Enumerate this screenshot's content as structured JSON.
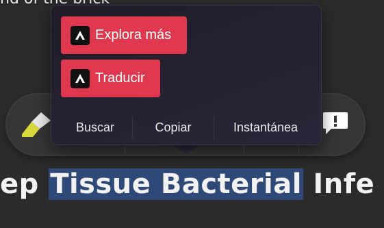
{
  "background": {
    "top_text": "nd of the brick",
    "heading_before": "ep ",
    "heading_selected": "Tissue Bacterial",
    "heading_after": " Infe"
  },
  "popup": {
    "actions": [
      {
        "label": "Explora más",
        "icon": "app-logo-icon"
      },
      {
        "label": "Traducir",
        "icon": "app-logo-icon"
      }
    ],
    "tabs": [
      "Buscar",
      "Copiar",
      "Instantánea"
    ]
  },
  "toolbar": {
    "icons": [
      "eraser-icon",
      "feedback-icon"
    ]
  },
  "colors": {
    "accent": "#e0384f",
    "selection": "#2e4878",
    "popup_bg": "#252233"
  }
}
